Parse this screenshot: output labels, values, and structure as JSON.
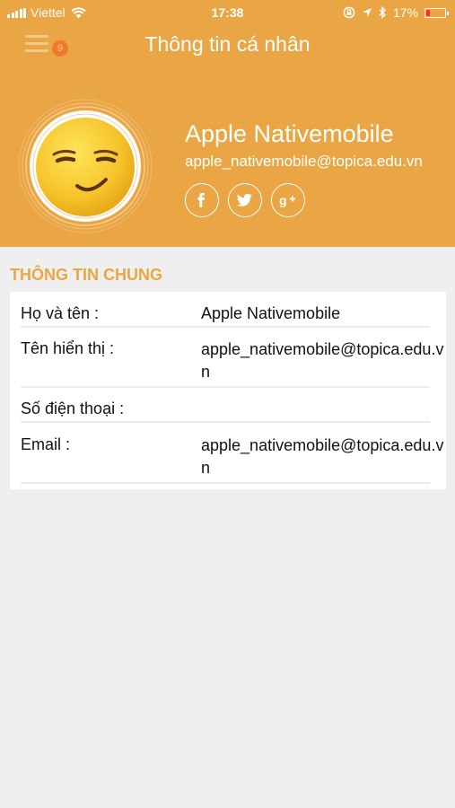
{
  "status_bar": {
    "carrier": "Viettel",
    "time": "17:38",
    "battery_percent": "17%",
    "battery_level": 0.17,
    "icons": [
      "signal-icon",
      "wifi-icon",
      "rotation-lock-icon",
      "location-icon",
      "bluetooth-icon",
      "battery-icon"
    ]
  },
  "nav": {
    "title": "Thông tin cá nhân",
    "menu_badge": "9",
    "menu_icon": "hamburger-menu-icon"
  },
  "profile": {
    "name": "Apple Nativemobile",
    "email": "apple_nativemobile@topica.edu.vn",
    "avatar": "smirk-emoji-avatar",
    "social": [
      "facebook-icon",
      "twitter-icon",
      "google-plus-icon"
    ]
  },
  "section": {
    "title": "THÔNG TIN CHUNG"
  },
  "info_rows": [
    {
      "label": "Họ và tên :",
      "value": "Apple Nativemobile"
    },
    {
      "label": "Tên hiển thị :",
      "value": "apple_nativemobile@topica.edu.vn"
    },
    {
      "label": "Số điện thoại :",
      "value": ""
    },
    {
      "label": "Email :",
      "value": "apple_nativemobile@topica.edu.vn"
    }
  ],
  "colors": {
    "header": "#eaa645",
    "section_title": "#eaa645",
    "background": "#efefef",
    "badge": "#f07a2a"
  }
}
